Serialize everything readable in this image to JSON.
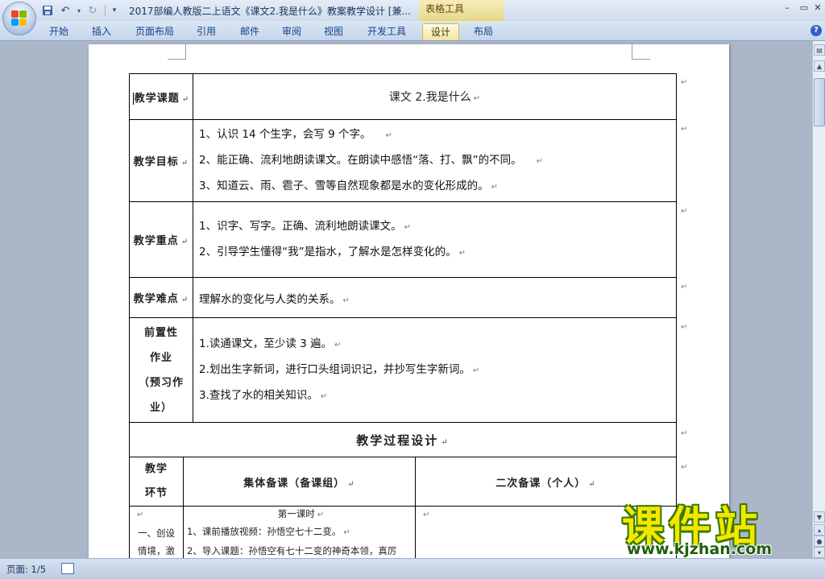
{
  "titlebar": {
    "doc_title": "2017部编人教版二上语文《课文2.我是什么》教案教学设计 [兼...",
    "context_tab_title": "表格工具",
    "minimize": "–",
    "restore": "▭"
  },
  "ribbon": {
    "tabs": [
      "开始",
      "插入",
      "页面布局",
      "引用",
      "邮件",
      "审阅",
      "视图",
      "开发工具",
      "设计",
      "布局"
    ],
    "active_tab": "设计",
    "help": "?"
  },
  "document": {
    "paragraph_mark": "↵",
    "rows": {
      "topic": {
        "label": "教学课题",
        "value": "课文 2.我是什么"
      },
      "goals": {
        "label": "教学目标",
        "lines": [
          "1、认识 14 个生字，会写 9 个字。",
          "2、能正确、流利地朗读课文。在朗读中感悟“落、打、飘”的不同。",
          "3、知道云、雨、雹子、雪等自然现象都是水的变化形成的。"
        ]
      },
      "key_points": {
        "label": "教学重点",
        "lines": [
          "1、识字、写字。正确、流利地朗读课文。",
          "2、引导学生懂得“我”是指水，了解水是怎样变化的。"
        ]
      },
      "difficulty": {
        "label": "教学难点",
        "value": "理解水的变化与人类的关系。"
      },
      "preview": {
        "label_lines": [
          "前置性",
          "作业",
          "（预习作",
          "业）"
        ],
        "lines": [
          "1.读通课文，至少读 3 遍。",
          "2.划出生字新词，进行口头组词识记，并抄写生字新词。",
          "3.查找了水的相关知识。"
        ]
      },
      "process_title": "教学过程设计",
      "process_header": {
        "stage_lines": [
          "教学",
          "环节"
        ],
        "group_prep": "集体备课（备课组）",
        "personal_prep": "二次备课（个人）"
      },
      "process_row": {
        "stage_lines": [
          "一、创设",
          "情境，激"
        ],
        "lesson": "第一课时",
        "lines": [
          "1、课前播放视频：孙悟空七十二变。",
          "2、导入课题：孙悟空有七十二变的神奇本领，真厉"
        ]
      }
    }
  },
  "statusbar": {
    "page": "页面: 1/5"
  },
  "watermark": {
    "main": "课件站",
    "url": "www.kjzhan.com"
  }
}
